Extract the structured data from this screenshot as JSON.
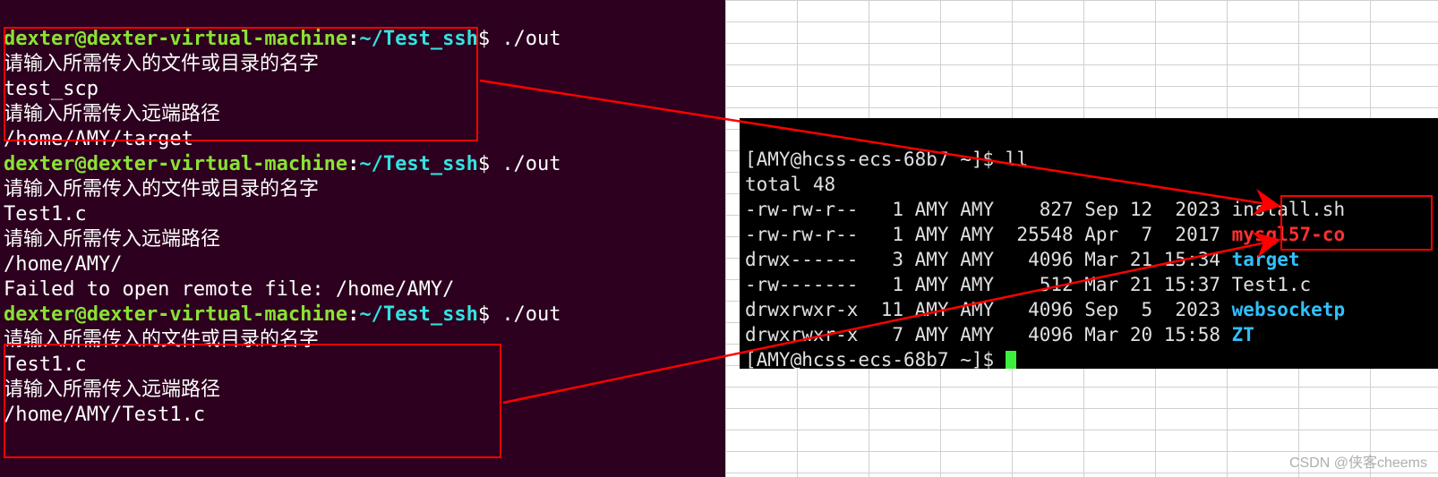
{
  "left": {
    "prompt": {
      "user_host": "dexter@dexter-virtual-machine",
      "colon": ":",
      "path": "~/Test_ssh",
      "dollar": "$",
      "cmd": "./out"
    },
    "block1": {
      "l1": "请输入所需传入的文件或目录的名字",
      "l2": "test_scp",
      "l3": "请输入所需传入远端路径",
      "l4": "/home/AMY/target"
    },
    "block2": {
      "l1": "请输入所需传入的文件或目录的名字",
      "l2": "Test1.c",
      "l3": "请输入所需传入远端路径",
      "l4": "/home/AMY/",
      "l5": "Failed to open remote file: /home/AMY/"
    },
    "block3": {
      "l1": "请输入所需传入的文件或目录的名字",
      "l2": "Test1.c",
      "l3": "请输入所需传入远端路径",
      "l4": "/home/AMY/Test1.c"
    }
  },
  "right": {
    "prompt": "[AMY@hcss-ecs-68b7 ~]$ ",
    "cmd": "ll",
    "total": "total 48",
    "rows": [
      {
        "perm": "-rw-rw-r--",
        "links": " 1",
        "owner": "AMY",
        "group": "AMY",
        "size": "   827",
        "date": "Sep 12  2023",
        "name": "install.sh",
        "cls": "r-white"
      },
      {
        "perm": "-rw-rw-r--",
        "links": " 1",
        "owner": "AMY",
        "group": "AMY",
        "size": " 25548",
        "date": "Apr  7  2017",
        "name": "mysql57-co",
        "cls": "r-red"
      },
      {
        "perm": "drwx------",
        "links": " 3",
        "owner": "AMY",
        "group": "AMY",
        "size": "  4096",
        "date": "Mar 21 15:34",
        "name": "target",
        "cls": "r-cyan"
      },
      {
        "perm": "-rw-------",
        "links": " 1",
        "owner": "AMY",
        "group": "AMY",
        "size": "   512",
        "date": "Mar 21 15:37",
        "name": "Test1.c",
        "cls": "r-white"
      },
      {
        "perm": "drwxrwxr-x",
        "links": "11",
        "owner": "AMY",
        "group": "AMY",
        "size": "  4096",
        "date": "Sep  5  2023",
        "name": "websocketp",
        "cls": "r-cyan"
      },
      {
        "perm": "drwxrwxr-x",
        "links": " 7",
        "owner": "AMY",
        "group": "AMY",
        "size": "  4096",
        "date": "Mar 20 15:58",
        "name": "ZT",
        "cls": "r-cyan"
      }
    ]
  },
  "watermark": "CSDN @侠客cheems"
}
